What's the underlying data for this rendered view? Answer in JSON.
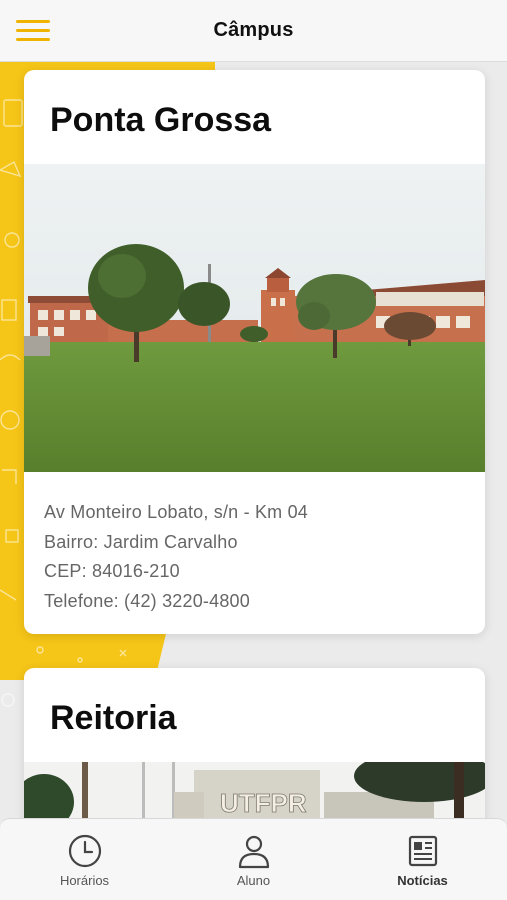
{
  "header": {
    "title": "Câmpus"
  },
  "campuses": [
    {
      "name": "Ponta Grossa",
      "photo_icon": "campus-building-photo",
      "address_lines": [
        "Av Monteiro Lobato, s/n - Km 04",
        "Bairro: Jardim Carvalho",
        "CEP: 84016-210",
        "Telefone: (42) 3220-4800"
      ]
    },
    {
      "name": "Reitoria",
      "photo_icon": "reitoria-building-photo",
      "photo_sign_text": "UTFPR"
    }
  ],
  "tabs": [
    {
      "label": "Horários",
      "icon": "clock-icon"
    },
    {
      "label": "Aluno",
      "icon": "user-icon"
    },
    {
      "label": "Notícias",
      "icon": "newspaper-icon"
    }
  ],
  "colors": {
    "accent": "#f5c518",
    "menu_icon": "#f0b400",
    "background": "#ebebeb"
  }
}
